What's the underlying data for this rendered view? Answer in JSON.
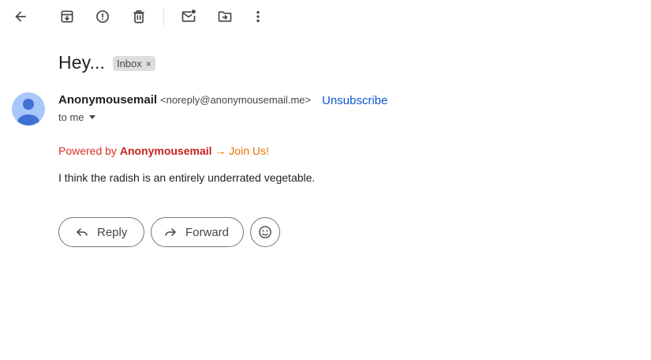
{
  "toolbar": {
    "icons": [
      "back-arrow-icon",
      "archive-icon",
      "report-spam-icon",
      "delete-icon",
      "mark-unread-icon",
      "move-to-icon",
      "more-options-icon"
    ]
  },
  "message": {
    "subject": "Hey...",
    "label_chip": "Inbox",
    "label_remove": "×",
    "sender_name": "Anonymousemail",
    "sender_email": "<noreply@anonymousemail.me>",
    "unsubscribe": "Unsubscribe",
    "to_line": "to me",
    "powered_prefix": "Powered by ",
    "powered_brand": "Anonymousemail",
    "powered_link": " → Join Us!",
    "body": "I think the radish is an entirely underrated vegetable."
  },
  "actions": {
    "reply_label": "Reply",
    "forward_label": "Forward"
  },
  "colors": {
    "link_blue": "#0b57d0",
    "powered_red": "#d93025",
    "join_orange": "#e37400",
    "avatar_bg": "#a8c7fa",
    "avatar_fg": "#3f70d4"
  }
}
